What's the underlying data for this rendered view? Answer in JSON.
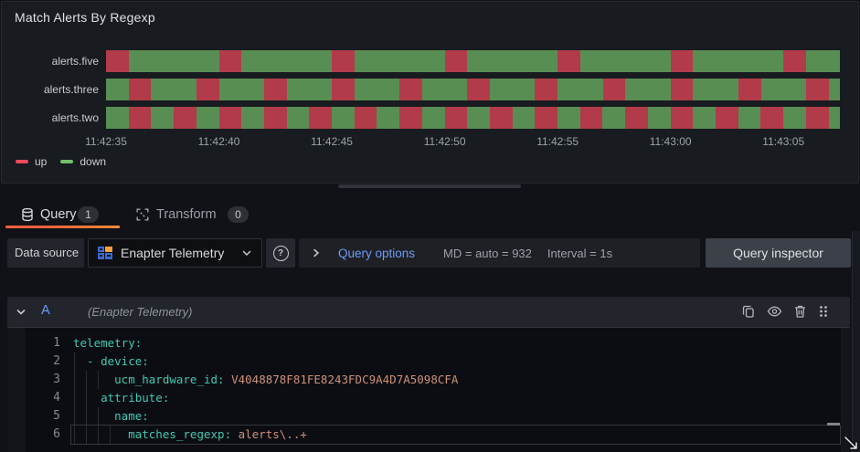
{
  "panel": {
    "title": "Match Alerts By Regexp"
  },
  "chart_data": {
    "type": "state-timeline",
    "title": "Match Alerts By Regexp",
    "x_ticks": [
      "11:42:35",
      "11:42:40",
      "11:42:45",
      "11:42:50",
      "11:42:55",
      "11:43:00",
      "11:43:05"
    ],
    "tick_interval_s": 5,
    "total_span_s": 32.5,
    "grid": false,
    "legend_position": "bottom-left",
    "states": {
      "up": "#b23b4a",
      "down": "#588e53"
    },
    "legend": [
      {
        "label": "up",
        "color": "#f2495c"
      },
      {
        "label": "down",
        "color": "#73bf69"
      }
    ],
    "rows": [
      {
        "label": "alerts.five",
        "segments": [
          [
            "up",
            1
          ],
          [
            "down",
            4
          ],
          [
            "up",
            1
          ],
          [
            "down",
            4
          ],
          [
            "up",
            1
          ],
          [
            "down",
            4
          ],
          [
            "up",
            1
          ],
          [
            "down",
            4
          ],
          [
            "up",
            1
          ],
          [
            "down",
            4
          ],
          [
            "up",
            1
          ],
          [
            "down",
            4
          ],
          [
            "up",
            1
          ],
          [
            "down",
            1.5
          ]
        ]
      },
      {
        "label": "alerts.three",
        "segments": [
          [
            "down",
            1
          ],
          [
            "up",
            1
          ],
          [
            "down",
            2
          ],
          [
            "up",
            1
          ],
          [
            "down",
            2
          ],
          [
            "up",
            1
          ],
          [
            "down",
            2
          ],
          [
            "up",
            1
          ],
          [
            "down",
            2
          ],
          [
            "up",
            1
          ],
          [
            "down",
            2
          ],
          [
            "up",
            1
          ],
          [
            "down",
            2
          ],
          [
            "up",
            1
          ],
          [
            "down",
            2
          ],
          [
            "up",
            1
          ],
          [
            "down",
            2
          ],
          [
            "up",
            1
          ],
          [
            "down",
            2
          ],
          [
            "up",
            1
          ],
          [
            "down",
            2
          ],
          [
            "up",
            1
          ],
          [
            "down",
            0.5
          ]
        ]
      },
      {
        "label": "alerts.two",
        "segments": [
          [
            "down",
            1
          ],
          [
            "up",
            1
          ],
          [
            "down",
            1
          ],
          [
            "up",
            1
          ],
          [
            "down",
            1
          ],
          [
            "up",
            1
          ],
          [
            "down",
            1
          ],
          [
            "up",
            1
          ],
          [
            "down",
            1
          ],
          [
            "up",
            1
          ],
          [
            "down",
            1
          ],
          [
            "up",
            1
          ],
          [
            "down",
            1
          ],
          [
            "up",
            1
          ],
          [
            "down",
            1
          ],
          [
            "up",
            1
          ],
          [
            "down",
            1
          ],
          [
            "up",
            1
          ],
          [
            "down",
            1
          ],
          [
            "up",
            1
          ],
          [
            "down",
            1
          ],
          [
            "up",
            1
          ],
          [
            "down",
            1
          ],
          [
            "up",
            1
          ],
          [
            "down",
            1
          ],
          [
            "up",
            1
          ],
          [
            "down",
            1
          ],
          [
            "up",
            1
          ],
          [
            "down",
            1
          ],
          [
            "up",
            1
          ],
          [
            "down",
            1
          ],
          [
            "up",
            1
          ],
          [
            "down",
            0.5
          ]
        ]
      }
    ]
  },
  "tabs": {
    "query": {
      "label": "Query",
      "badge": "1"
    },
    "transform": {
      "label": "Transform",
      "badge": "0"
    }
  },
  "datasource": {
    "label": "Data source",
    "picker_value": "Enapter Telemetry",
    "options": {
      "label": "Query options",
      "max_data": "MD = auto = 932",
      "interval": "Interval = 1s"
    },
    "inspector_label": "Query inspector"
  },
  "query_row": {
    "ref_id": "A",
    "datasource_hint": "(Enapter Telemetry)"
  },
  "editor": {
    "colors": {
      "key": "#3fc9b2",
      "str": "#ce9178"
    },
    "lines": [
      {
        "num": "1",
        "guides": 0,
        "parts": [
          [
            "key",
            "telemetry:"
          ]
        ]
      },
      {
        "num": "2",
        "guides": 1,
        "parts": [
          [
            "key",
            "  - device:"
          ]
        ]
      },
      {
        "num": "3",
        "guides": 3,
        "parts": [
          [
            "key",
            "      ucm_hardware_id: "
          ],
          [
            "str",
            "V4048878F81FE8243FDC9A4D7A5098CFA"
          ]
        ]
      },
      {
        "num": "4",
        "guides": 2,
        "parts": [
          [
            "key",
            "    attribute:"
          ]
        ]
      },
      {
        "num": "5",
        "guides": 3,
        "parts": [
          [
            "key",
            "      name:"
          ]
        ]
      },
      {
        "num": "6",
        "guides": 4,
        "current": true,
        "parts": [
          [
            "key",
            "        matches_regexp: "
          ],
          [
            "str",
            "alerts\\..+"
          ]
        ]
      }
    ]
  }
}
